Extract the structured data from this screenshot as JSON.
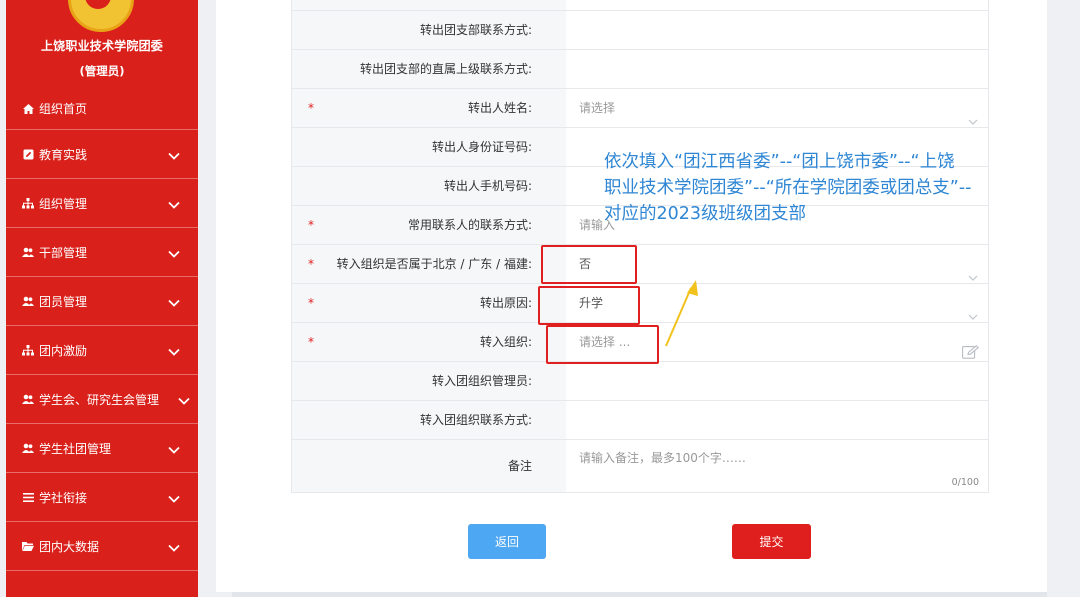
{
  "sidebar": {
    "org_name": "上饶职业技术学院团委",
    "role": "(管理员)",
    "items": [
      {
        "label": "组织首页",
        "icon": "home-icon"
      },
      {
        "label": "教育实践",
        "icon": "edit-icon"
      },
      {
        "label": "组织管理",
        "icon": "org-chart-icon"
      },
      {
        "label": "干部管理",
        "icon": "users-icon"
      },
      {
        "label": "团员管理",
        "icon": "users-icon"
      },
      {
        "label": "团内激励",
        "icon": "org-chart-icon"
      },
      {
        "label": "学生会、研究生会管理",
        "icon": "users-icon"
      },
      {
        "label": "学生社团管理",
        "icon": "users-icon"
      },
      {
        "label": "学社衔接",
        "icon": "list-icon"
      },
      {
        "label": "团内大数据",
        "icon": "folder-icon"
      }
    ]
  },
  "form": {
    "rows": [
      {
        "label": "转出团支部联系方式:",
        "required": false,
        "value": "",
        "placeholder": ""
      },
      {
        "label": "转出团支部的直属上级联系方式:",
        "required": false,
        "value": "",
        "placeholder": ""
      },
      {
        "label": "转出人姓名:",
        "required": true,
        "value": "",
        "placeholder": "请选择"
      },
      {
        "label": "转出人身份证号码:",
        "required": false,
        "value": "",
        "placeholder": ""
      },
      {
        "label": "转出人手机号码:",
        "required": false,
        "value": "",
        "placeholder": ""
      },
      {
        "label": "常用联系人的联系方式:",
        "required": true,
        "value": "",
        "placeholder": "请输入"
      },
      {
        "label": "转入组织是否属于北京 / 广东 / 福建:",
        "required": true,
        "value": "否",
        "placeholder": ""
      },
      {
        "label": "转出原因:",
        "required": true,
        "value": "升学",
        "placeholder": ""
      },
      {
        "label": "转入组织:",
        "required": true,
        "value": "",
        "placeholder": "请选择 ..."
      },
      {
        "label": "转入团组织管理员:",
        "required": false,
        "value": "",
        "placeholder": ""
      },
      {
        "label": "转入团组织联系方式:",
        "required": false,
        "value": "",
        "placeholder": ""
      }
    ],
    "memo": {
      "label": "备注",
      "placeholder": "请输入备注，最多100个字……",
      "counter": "0/100"
    },
    "required_mark": "*"
  },
  "annotation": {
    "line1": "依次填入“团江西省委”--“团上饶市委”--“上饶",
    "line2": "职业技术学院团委”--“所在学院团委或团总支”--",
    "line3": "对应的2023级班级团支部"
  },
  "buttons": {
    "back": "返回",
    "submit": "提交"
  },
  "colors": {
    "sidebar": "#d9201b",
    "annotation": "#2e86d4",
    "highlight": "#e02020",
    "back_button": "#4ea7f2",
    "submit_button": "#df1f1d"
  }
}
